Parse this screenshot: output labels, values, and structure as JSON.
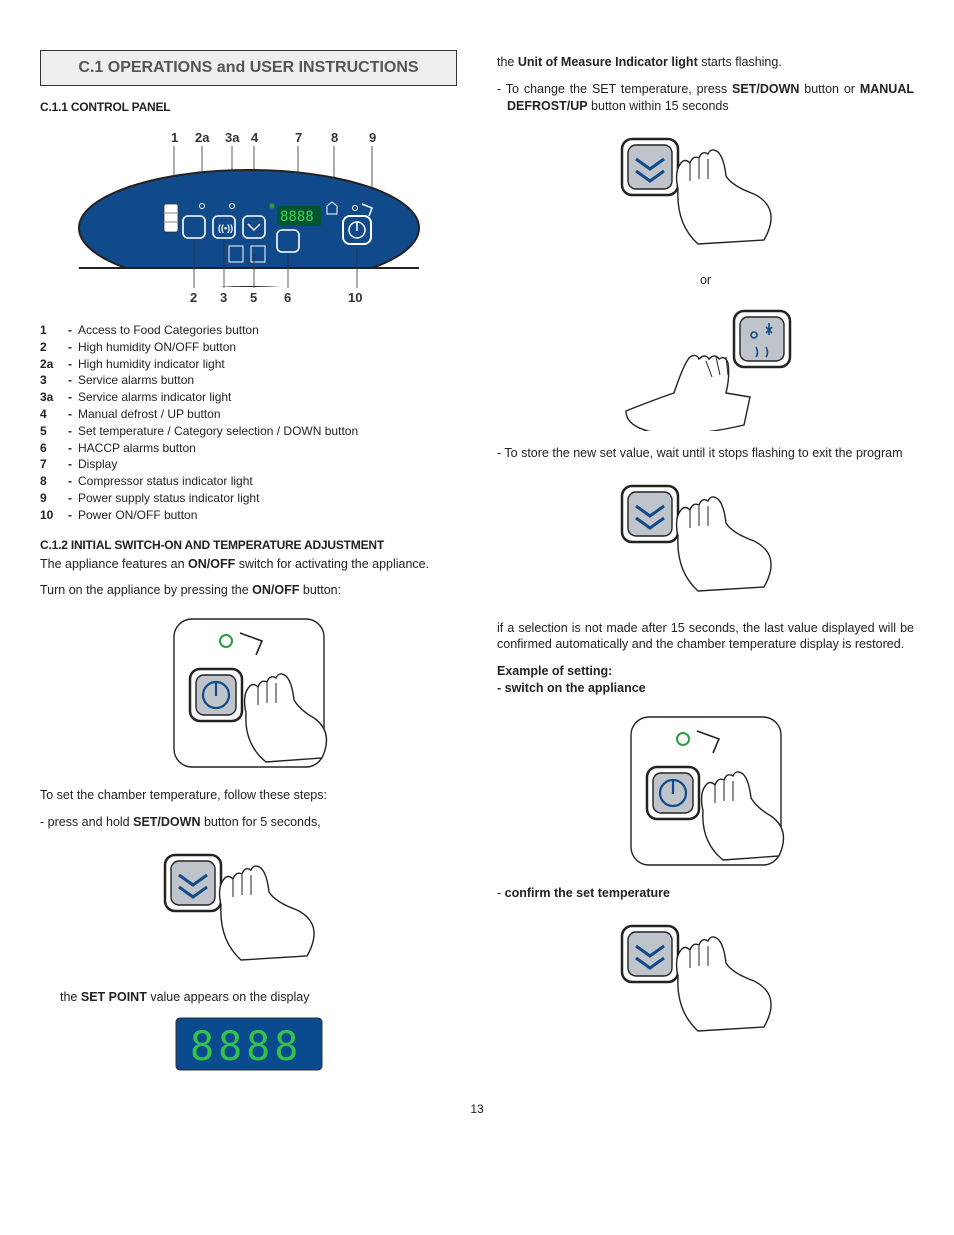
{
  "section": {
    "title": "C.1 OPERATIONS and USER INSTRUCTIONS"
  },
  "c11": {
    "heading": "C.1.1 CONTROL PANEL",
    "labels": {
      "l1": "1",
      "l2a": "2a",
      "l3a": "3a",
      "l4": "4",
      "l7": "7",
      "l8": "8",
      "l9": "9",
      "l2": "2",
      "l3": "3",
      "l5": "5",
      "l6": "6",
      "l10": "10"
    },
    "legend": [
      {
        "n": "1",
        "t": "Access to Food Categories button"
      },
      {
        "n": "2",
        "t": "High humidity ON/OFF button"
      },
      {
        "n": "2a",
        "t": "High humidity indicator light"
      },
      {
        "n": "3",
        "t": "Service alarms button"
      },
      {
        "n": "3a",
        "t": "Service alarms indicator light"
      },
      {
        "n": "4",
        "t": "Manual defrost / UP button"
      },
      {
        "n": "5",
        "t": "Set temperature / Category selection / DOWN button"
      },
      {
        "n": "6",
        "t": "HACCP alarms button"
      },
      {
        "n": "7",
        "t": "Display"
      },
      {
        "n": "8",
        "t": "Compressor status indicator light"
      },
      {
        "n": "9",
        "t": "Power supply status indicator light"
      },
      {
        "n": "10",
        "t": "Power ON/OFF button"
      }
    ]
  },
  "c12": {
    "heading": "C.1.2 INITIAL SWITCH-ON AND TEMPERATURE ADJUSTMENT",
    "p1a": "The appliance features an ",
    "p1b": "ON/OFF",
    "p1c": " switch for activating the appliance.",
    "p2a": "Turn on the appliance by pressing the ",
    "p2b": "ON/OFF",
    "p2c": " button:",
    "p3": "To set the chamber temperature, follow these steps:",
    "p3a": "- press and hold ",
    "p3b": "SET/DOWN",
    "p3c": " button for 5 seconds,",
    "p4a": "the ",
    "p4b": "SET POINT",
    "p4c": " value appears on the display"
  },
  "right": {
    "p1a": "the ",
    "p1b": "Unit of Measure Indicator light",
    "p1c": " starts flashing.",
    "p2a": "- To change the SET temperature, press ",
    "p2b": "SET/DOWN",
    "p2c": " button or ",
    "p2d": "MANUAL DEFROST/UP",
    "p2e": " button within 15 seconds",
    "or": "or",
    "p3": "- To store the new set value, wait until it stops flashing to exit the program",
    "p4": "if a selection is not made after 15 seconds, the last value displayed will be confirmed automatically and the chamber temperature display is restored.",
    "ex1": "Example of setting:",
    "ex2": "- switch on the appliance",
    "ex3a": "- ",
    "ex3b": "confirm the set temperature"
  },
  "page": "13",
  "display_digits": "8888"
}
